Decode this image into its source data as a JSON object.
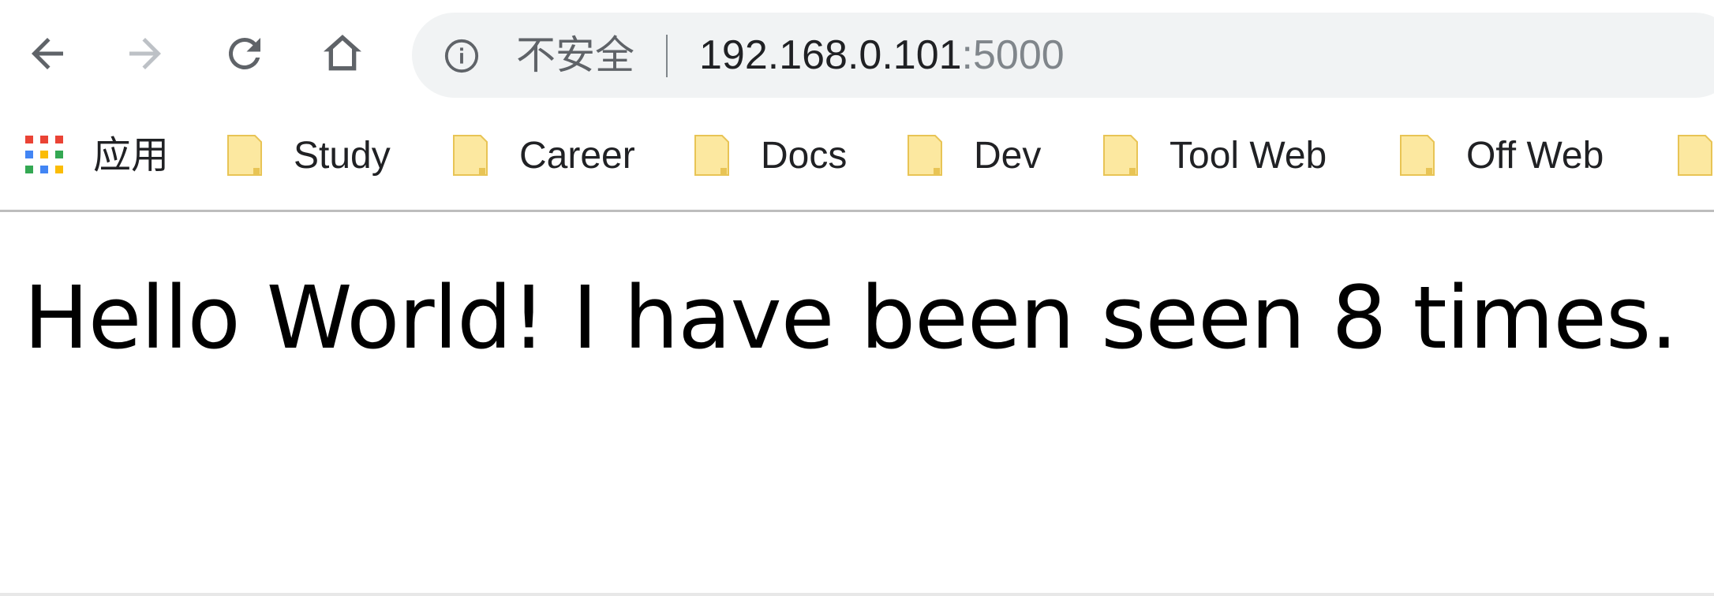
{
  "toolbar": {
    "back_icon": "arrow-left-icon",
    "forward_icon": "arrow-right-icon",
    "reload_icon": "reload-icon",
    "home_icon": "home-icon"
  },
  "omnibox": {
    "info_icon": "info-icon",
    "security_label": "不安全",
    "url_host": "192.168.0.101",
    "url_port": ":5000"
  },
  "bookmarks": {
    "apps_label": "应用",
    "items": [
      {
        "label": "Study"
      },
      {
        "label": "Career"
      },
      {
        "label": "Docs"
      },
      {
        "label": "Dev"
      },
      {
        "label": "Tool Web"
      },
      {
        "label": "Off Web"
      }
    ],
    "folder_color": "#fce8a0"
  },
  "page": {
    "message": "Hello World! I have been seen 8 times."
  }
}
